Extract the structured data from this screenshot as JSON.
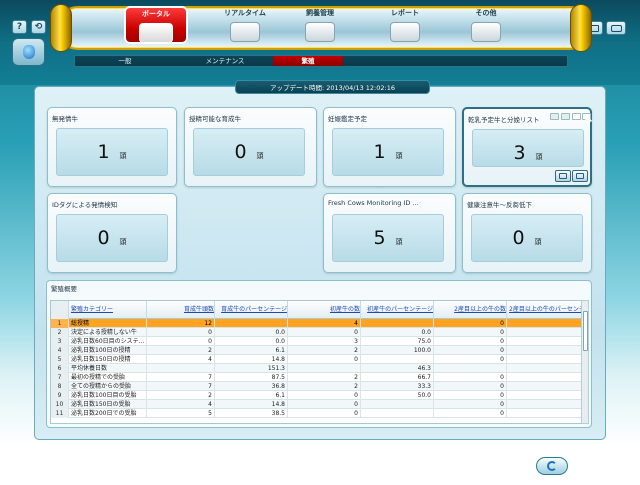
{
  "nav": {
    "items": [
      {
        "label": "ポータル",
        "icon": "cow-icon"
      },
      {
        "label": "リアルタイム",
        "icon": "tank-icon"
      },
      {
        "label": "飼養管理",
        "icon": "feed-icon"
      },
      {
        "label": "レポート",
        "icon": "report-icon"
      },
      {
        "label": "その他",
        "icon": "box-icon"
      }
    ],
    "subtabs": [
      "一般",
      "メンテナンス",
      "繁殖"
    ],
    "active_subtab": "繁殖"
  },
  "toolbar": {
    "help": "?",
    "swap": "⟲",
    "win": "",
    "settings": ""
  },
  "update": {
    "text": "アップデート時間:  2013/04/13 12:02:16"
  },
  "cards": [
    {
      "title": "無発情牛",
      "value": "1",
      "unit": "頭"
    },
    {
      "title": "授精可能な育成牛",
      "value": "0",
      "unit": "頭"
    },
    {
      "title": "妊娠鑑定予定",
      "value": "1",
      "unit": "頭"
    },
    {
      "title": "乾乳予定牛と分娩リスト",
      "value": "3",
      "unit": "頭"
    },
    {
      "title": "IDタグによる発情検知",
      "value": "0",
      "unit": "頭"
    },
    {
      "title": "Fresh Cows Monitoring ID ...",
      "value": "5",
      "unit": "頭"
    },
    {
      "title": "健康注意牛～反芻低下",
      "value": "0",
      "unit": "頭"
    }
  ],
  "table": {
    "title": "繁殖概要",
    "columns": [
      "",
      "繁殖カテゴリー",
      "育成牛頭数",
      "育成牛のパーセンテージ",
      "初産牛の数",
      "初産牛のパーセンテージ",
      "2産目以上の牛の数",
      "2産目以上の牛のパーセンテージ"
    ],
    "rows": [
      [
        "1",
        "総授精",
        "12",
        "",
        "4",
        "",
        "0",
        ""
      ],
      [
        "2",
        "決定による授精しない牛",
        "0",
        "0.0",
        "0",
        "0.0",
        "0",
        ""
      ],
      [
        "3",
        "泌乳日数60日目のシステ...",
        "0",
        "0.0",
        "3",
        "75.0",
        "0",
        ""
      ],
      [
        "4",
        "泌乳日数100日の授精",
        "2",
        "6.1",
        "2",
        "100.0",
        "0",
        ""
      ],
      [
        "5",
        "泌乳日数150日の授精",
        "4",
        "14.8",
        "0",
        "",
        "0",
        ""
      ],
      [
        "6",
        "平均休養日数",
        "",
        "151.3",
        "",
        "46.3",
        "",
        ""
      ],
      [
        "7",
        "最初の授精での受胎",
        "7",
        "87.5",
        "2",
        "66.7",
        "0",
        ""
      ],
      [
        "8",
        "全ての授精からの受胎",
        "7",
        "36.8",
        "2",
        "33.3",
        "0",
        ""
      ],
      [
        "9",
        "泌乳日数100日目の受胎",
        "2",
        "6.1",
        "0",
        "50.0",
        "0",
        ""
      ],
      [
        "10",
        "泌乳日数150日の受胎",
        "4",
        "14.8",
        "0",
        "",
        "0",
        ""
      ],
      [
        "11",
        "泌乳日数200日での受胎",
        "5",
        "38.5",
        "0",
        "",
        "0",
        ""
      ]
    ]
  }
}
